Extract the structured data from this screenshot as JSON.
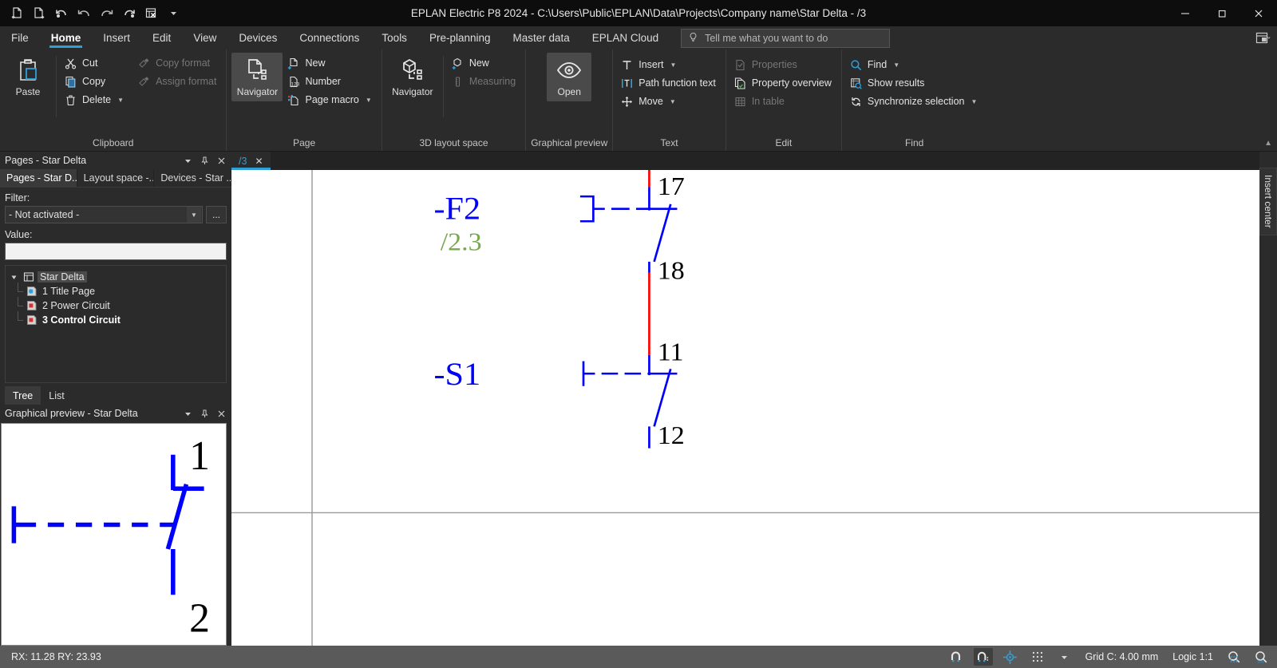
{
  "window": {
    "title": "EPLAN Electric P8 2024 - C:\\Users\\Public\\EPLAN\\Data\\Projects\\Company name\\Star Delta - /3",
    "minimize": "─",
    "maximize": "❐",
    "close": "✕"
  },
  "quick_access": [
    {
      "name": "new-page-icon",
      "title": "New page"
    },
    {
      "name": "open-page-icon",
      "title": "Open page"
    },
    {
      "name": "undo-icon",
      "title": "Undo"
    },
    {
      "name": "undo-list-icon",
      "title": "Undo list"
    },
    {
      "name": "redo-icon",
      "title": "Redo"
    },
    {
      "name": "redo-list-icon",
      "title": "Redo list"
    },
    {
      "name": "table-close-icon",
      "title": "Close table"
    },
    {
      "name": "qat-chevron-icon",
      "title": "Customize"
    }
  ],
  "menubar": {
    "items": [
      {
        "label": "File",
        "active": false
      },
      {
        "label": "Home",
        "active": true
      },
      {
        "label": "Insert",
        "active": false
      },
      {
        "label": "Edit",
        "active": false
      },
      {
        "label": "View",
        "active": false
      },
      {
        "label": "Devices",
        "active": false
      },
      {
        "label": "Connections",
        "active": false
      },
      {
        "label": "Tools",
        "active": false
      },
      {
        "label": "Pre-planning",
        "active": false
      },
      {
        "label": "Master data",
        "active": false
      },
      {
        "label": "EPLAN Cloud",
        "active": false
      }
    ],
    "search_placeholder": "Tell me what you want to do"
  },
  "ribbon": {
    "groups": [
      {
        "label": "Clipboard",
        "big": {
          "label": "Paste",
          "icon": "paste-icon"
        },
        "items": [
          {
            "label": "Cut",
            "icon": "cut-icon",
            "disabled": false,
            "chevron": false
          },
          {
            "label": "Copy",
            "icon": "copy-icon",
            "disabled": false,
            "chevron": false
          },
          {
            "label": "Delete",
            "icon": "delete-icon",
            "disabled": false,
            "chevron": true
          }
        ],
        "items2": [
          {
            "label": "Copy format",
            "icon": "copy-format-icon",
            "disabled": true,
            "chevron": false
          },
          {
            "label": "Assign format",
            "icon": "assign-format-icon",
            "disabled": true,
            "chevron": false
          }
        ]
      },
      {
        "label": "Page",
        "big": {
          "label": "Navigator",
          "icon": "page-navigator-icon",
          "selected": true
        },
        "items": [
          {
            "label": "New",
            "icon": "new-page-icon",
            "disabled": false,
            "chevron": false
          },
          {
            "label": "Number",
            "icon": "number-icon",
            "disabled": false,
            "chevron": false
          },
          {
            "label": "Page macro",
            "icon": "page-macro-icon",
            "disabled": false,
            "chevron": true
          }
        ]
      },
      {
        "label": "3D layout space",
        "big": {
          "label": "Navigator",
          "icon": "cube-navigator-icon"
        },
        "items": [
          {
            "label": "New",
            "icon": "new-cube-icon",
            "disabled": false,
            "chevron": false
          },
          {
            "label": "Measuring",
            "icon": "measuring-icon",
            "disabled": true,
            "chevron": false
          }
        ]
      },
      {
        "label": "Graphical preview",
        "big": {
          "label": "Open",
          "icon": "eye-icon",
          "selected": true
        }
      },
      {
        "label": "Text",
        "items": [
          {
            "label": "Insert",
            "icon": "text-insert-icon",
            "disabled": false,
            "chevron": true
          },
          {
            "label": "Path function text",
            "icon": "path-function-text-icon",
            "disabled": false,
            "chevron": false
          },
          {
            "label": "Move",
            "icon": "move-icon",
            "disabled": false,
            "chevron": true
          }
        ]
      },
      {
        "label": "Edit",
        "items": [
          {
            "label": "Properties",
            "icon": "properties-icon",
            "disabled": true,
            "chevron": false
          },
          {
            "label": "Property overview",
            "icon": "property-overview-icon",
            "disabled": false,
            "chevron": false
          },
          {
            "label": "In table",
            "icon": "in-table-icon",
            "disabled": true,
            "chevron": false
          }
        ]
      },
      {
        "label": "Find",
        "items": [
          {
            "label": "Find",
            "icon": "find-icon",
            "disabled": false,
            "chevron": true
          },
          {
            "label": "Show results",
            "icon": "show-results-icon",
            "disabled": false,
            "chevron": false
          },
          {
            "label": "Synchronize selection",
            "icon": "synchronize-selection-icon",
            "disabled": false,
            "chevron": true
          }
        ]
      }
    ]
  },
  "pages_panel": {
    "title": "Pages - Star Delta",
    "tabs": [
      {
        "label": "Pages - Star D...",
        "active": true
      },
      {
        "label": "Layout space -...",
        "active": false
      },
      {
        "label": "Devices - Star ...",
        "active": false
      }
    ],
    "filter_label": "Filter:",
    "filter_value": "- Not activated -",
    "filter_more": "...",
    "value_label": "Value:",
    "value_text": "",
    "tree": {
      "root": {
        "label": "Star Delta",
        "icon": "project-icon"
      },
      "children": [
        {
          "label": "1 Title Page",
          "icon": "title-page-icon",
          "bold": false
        },
        {
          "label": "2 Power Circuit",
          "icon": "page-icon",
          "bold": false
        },
        {
          "label": "3 Control Circuit",
          "icon": "page-icon",
          "bold": true
        }
      ]
    },
    "view_tabs": [
      {
        "label": "Tree",
        "active": true
      },
      {
        "label": "List",
        "active": false
      }
    ]
  },
  "preview_panel": {
    "title": "Graphical preview - Star Delta",
    "terminal_top": "1",
    "terminal_bottom": "2"
  },
  "document": {
    "tab_label": "/3",
    "tab_close": "✕",
    "schematic": {
      "devices": [
        {
          "name": "-F2",
          "cross_reference": "/2.3",
          "terminal_top": "17",
          "terminal_bottom": "18",
          "type": "nc-contact-thermal-overload"
        },
        {
          "name": "-S1",
          "terminal_top": "11",
          "terminal_bottom": "12",
          "type": "nc-contact-pushbutton"
        }
      ],
      "connection_color": "#ff0000",
      "symbol_color": "#0000ff",
      "terminal_label_color": "#000000",
      "cross_reference_color": "#76a94b"
    }
  },
  "right_rail": {
    "tab_label": "Insert center"
  },
  "statusbar": {
    "coordinates": "RX: 11.28 RY: 23.93",
    "grid": "Grid C: 4.00 mm",
    "logic": "Logic 1:1",
    "icons": [
      {
        "name": "snap-magnet-icon",
        "active": false
      },
      {
        "name": "snap-magnet-grid-icon",
        "active": true
      },
      {
        "name": "crosshair-icon",
        "active": false
      },
      {
        "name": "grid-dots-icon",
        "active": false
      },
      {
        "name": "grid-chevron-icon",
        "active": false
      },
      {
        "name": "zoom-window-icon",
        "active": false
      },
      {
        "name": "zoom-100-icon",
        "active": false
      }
    ]
  }
}
